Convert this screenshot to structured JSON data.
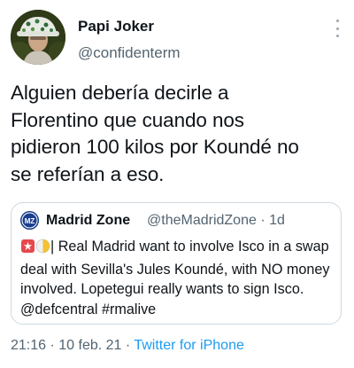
{
  "author": {
    "display_name": "Papi Joker",
    "handle": "@confidenterm"
  },
  "tweet": {
    "text": "Alguien debería decirle a\nFlorentino que cuando nos\npidieron 100 kilos por  Koundé no\nse referían a eso."
  },
  "quoted_tweet": {
    "display_name": "Madrid Zone",
    "handle": "@theMadridZone",
    "separator": "·",
    "time": "1d",
    "text": "Real Madrid want to involve Isco in a swap deal with Sevilla's Jules Koundé, with NO money involved. Lopetegui really wants to sign Isco. @defcentral #rmalive",
    "prefix_separator": "|"
  },
  "footer": {
    "timestamp": "21:16 · 10 feb. 21 · ",
    "source": "Twitter for iPhone"
  },
  "colors": {
    "text_primary": "#0f1419",
    "text_secondary": "#536471",
    "link": "#1d9bf0",
    "border": "#cfd9de"
  },
  "icons": {
    "more": "more-vertical-icon",
    "quote_logo": "madrid-zone-logo-icon",
    "siren": "siren-emoji-icon",
    "badge": "half-white-half-yellow-circle-emoji-icon"
  }
}
